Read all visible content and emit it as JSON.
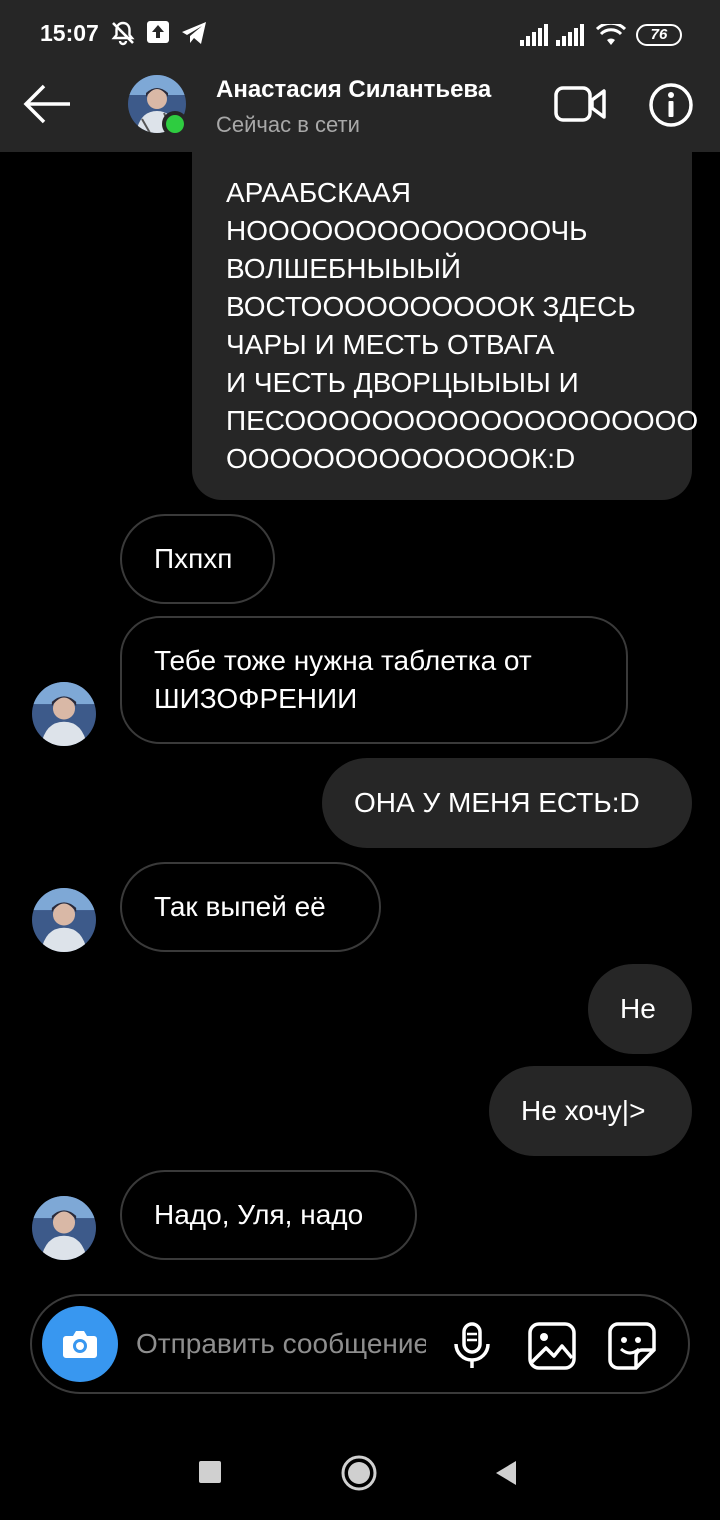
{
  "status_bar": {
    "time": "15:07",
    "battery": "76"
  },
  "header": {
    "contact_name": "Анастасия Силантьева",
    "contact_status": "Сейчас в сети"
  },
  "messages": [
    {
      "from": "me",
      "text": "АРААБСКААЯ\nНООООООООООООООЧЬ\nВОЛШЕБНЫЫЫЙ\nВОСТООООООООООК ЗДЕСЬ\nЧАРЫ И МЕСТЬ ОТВАГА\nИ ЧЕСТЬ ДВОРЦЫЫЫЫ И\nПЕСООООООООООООООООООО\nООООООООООООООК:D"
    },
    {
      "from": "them",
      "text": "Пхпхп"
    },
    {
      "from": "them",
      "text": "Тебе тоже нужна таблетка от\nШИЗОФРЕНИИ"
    },
    {
      "from": "me",
      "text": "ОНА У МЕНЯ ЕСТЬ:D"
    },
    {
      "from": "them",
      "text": "Так выпей её"
    },
    {
      "from": "me",
      "text": "Не"
    },
    {
      "from": "me",
      "text": "Не хочу|>"
    },
    {
      "from": "them",
      "text": "Надо, Уля, надо"
    }
  ],
  "composer": {
    "placeholder": "Отправить сообщение..."
  },
  "colors": {
    "background": "#000000",
    "bar": "#262626",
    "accent": "#3897f0",
    "online": "#2ecc40"
  },
  "icons": [
    "back-arrow-icon",
    "video-call-icon",
    "info-icon",
    "camera-icon",
    "microphone-icon",
    "gallery-icon",
    "sticker-icon"
  ]
}
